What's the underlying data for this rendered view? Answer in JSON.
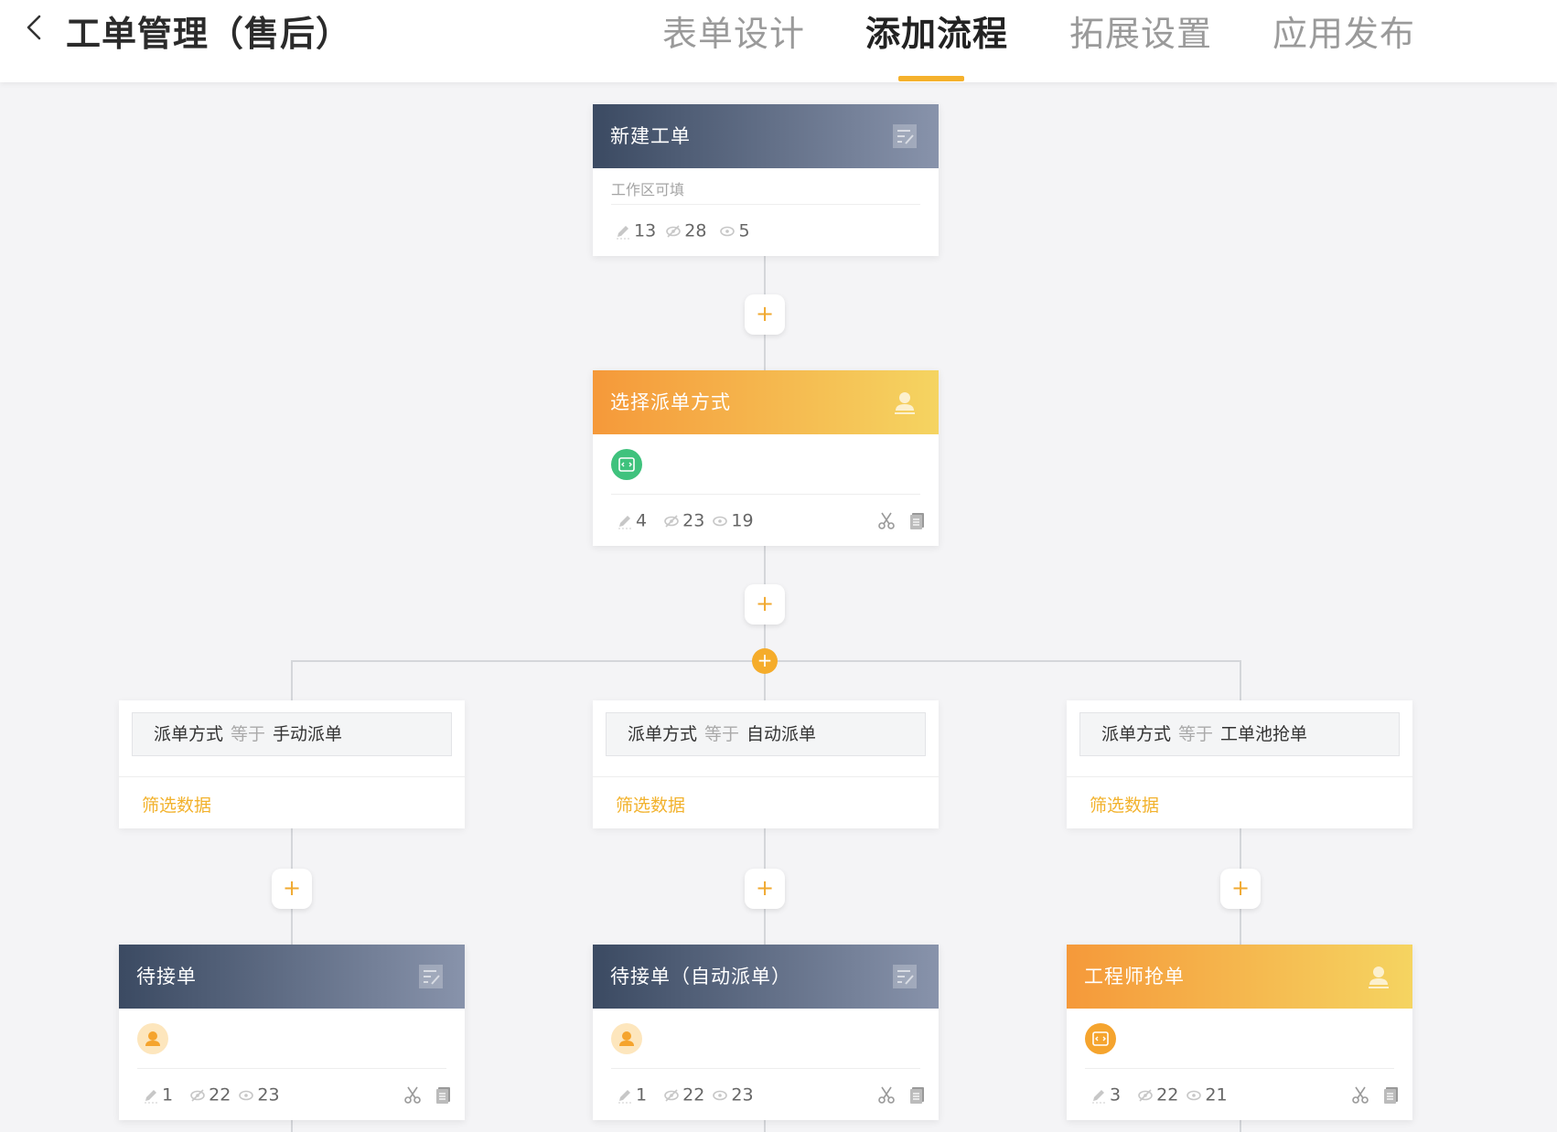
{
  "header": {
    "title": "工单管理（售后）",
    "tabs": [
      {
        "label": "表单设计",
        "active": false
      },
      {
        "label": "添加流程",
        "active": true
      },
      {
        "label": "拓展设置",
        "active": false
      },
      {
        "label": "应用发布",
        "active": false
      }
    ]
  },
  "flow": {
    "add_symbol": "+",
    "start_node": {
      "title": "新建工单",
      "subtitle": "工作区可填",
      "edit": "13",
      "hidden": "28",
      "view": "5"
    },
    "dispatch_node": {
      "title": "选择派单方式",
      "edit": "4",
      "hidden": "23",
      "view": "19"
    },
    "branches": [
      {
        "field": "派单方式",
        "op": "等于",
        "value": "手动派单",
        "filter": "筛选数据"
      },
      {
        "field": "派单方式",
        "op": "等于",
        "value": "自动派单",
        "filter": "筛选数据"
      },
      {
        "field": "派单方式",
        "op": "等于",
        "value": "工单池抢单",
        "filter": "筛选数据"
      }
    ],
    "nodes": [
      {
        "title": "待接单",
        "edit": "1",
        "hidden": "22",
        "view": "23"
      },
      {
        "title": "待接单（自动派单）",
        "edit": "1",
        "hidden": "22",
        "view": "23"
      },
      {
        "title": "工程师抢单",
        "edit": "3",
        "hidden": "22",
        "view": "21"
      }
    ]
  },
  "colors": {
    "accent": "#f5b12c",
    "dark_header": "#3b4a62",
    "orange_header": "#f5993a",
    "green_icon": "#3fc27d"
  }
}
